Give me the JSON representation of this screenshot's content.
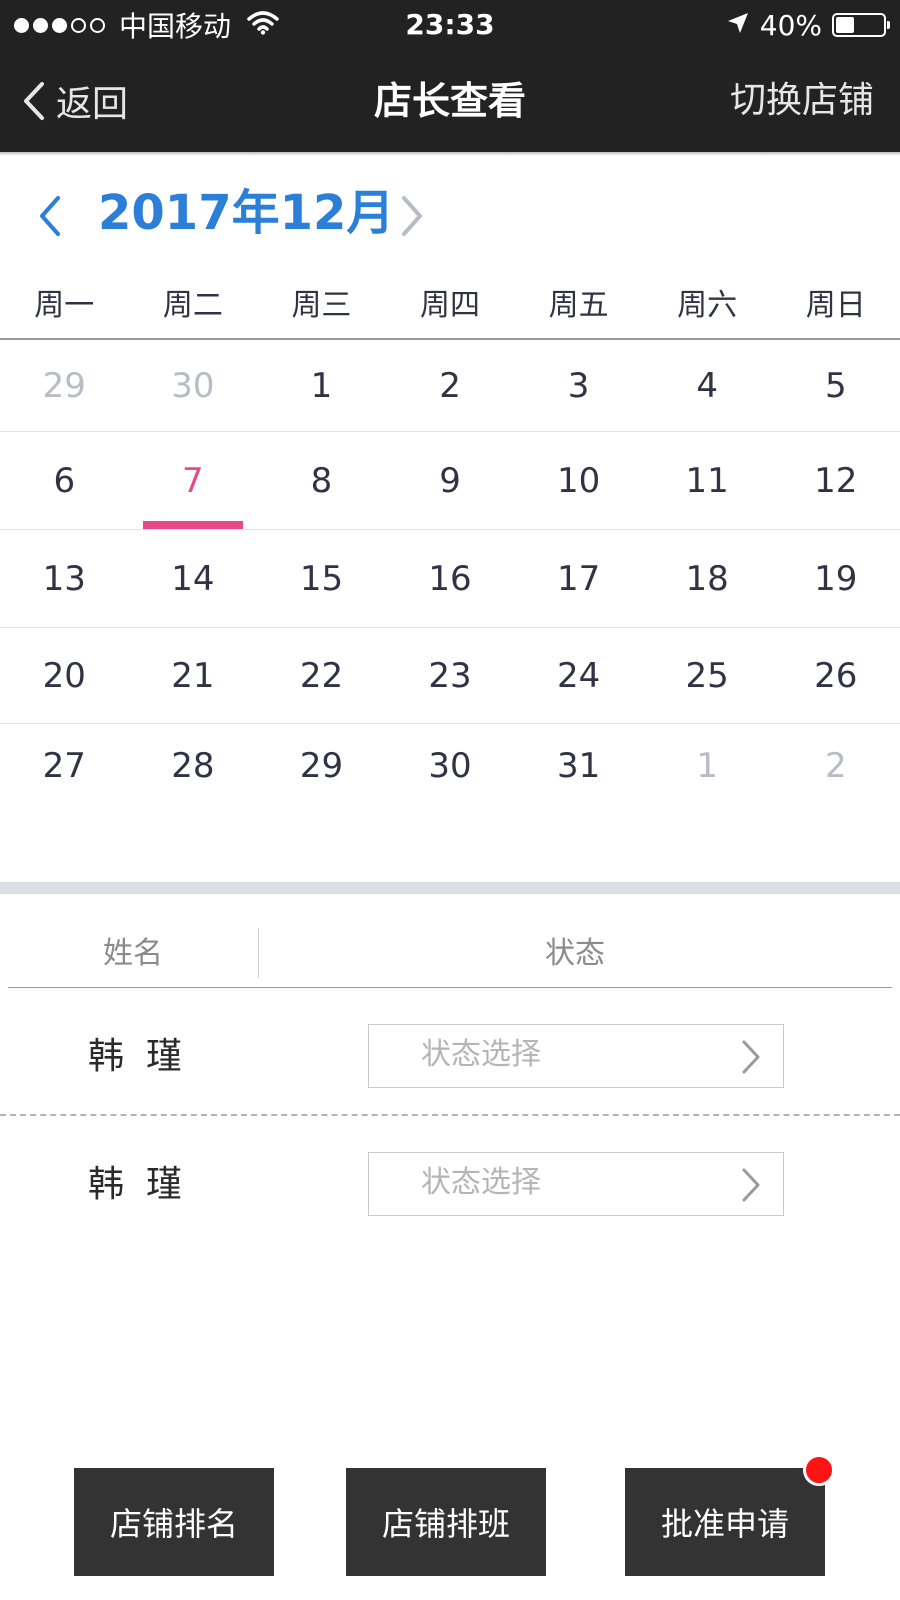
{
  "status_bar": {
    "carrier": "中国移动",
    "time": "23:33",
    "battery": "40%",
    "battery_level": 0.4,
    "signal_bars_filled": 3,
    "signal_bars_total": 5
  },
  "nav": {
    "back_label": "返回",
    "title": "店长查看",
    "switch_label": "切换店铺"
  },
  "calendar": {
    "month_label": "2017年12月",
    "accent_color": "#2b7fd6",
    "today_color": "#e74a86",
    "weekdays": [
      "周一",
      "周二",
      "周三",
      "周四",
      "周五",
      "周六",
      "周日"
    ],
    "weeks": [
      [
        {
          "d": "29",
          "m": true
        },
        {
          "d": "30",
          "m": true
        },
        {
          "d": "1"
        },
        {
          "d": "2"
        },
        {
          "d": "3"
        },
        {
          "d": "4"
        },
        {
          "d": "5"
        }
      ],
      [
        {
          "d": "6"
        },
        {
          "d": "7",
          "t": true
        },
        {
          "d": "8"
        },
        {
          "d": "9"
        },
        {
          "d": "10"
        },
        {
          "d": "11"
        },
        {
          "d": "12"
        }
      ],
      [
        {
          "d": "13"
        },
        {
          "d": "14"
        },
        {
          "d": "15"
        },
        {
          "d": "16"
        },
        {
          "d": "17"
        },
        {
          "d": "18"
        },
        {
          "d": "19"
        }
      ],
      [
        {
          "d": "20"
        },
        {
          "d": "21"
        },
        {
          "d": "22"
        },
        {
          "d": "23"
        },
        {
          "d": "24"
        },
        {
          "d": "25"
        },
        {
          "d": "26"
        }
      ],
      [
        {
          "d": "27"
        },
        {
          "d": "28"
        },
        {
          "d": "29"
        },
        {
          "d": "30"
        },
        {
          "d": "31"
        },
        {
          "d": "1",
          "m": true
        },
        {
          "d": "2",
          "m": true
        }
      ]
    ]
  },
  "staff_list": {
    "col_name": "姓名",
    "col_status": "状态",
    "rows": [
      {
        "name": "韩瑾",
        "status_placeholder": "状态选择"
      },
      {
        "name": "韩瑾",
        "status_placeholder": "状态选择"
      }
    ]
  },
  "bottom_buttons": [
    {
      "label": "店铺排名"
    },
    {
      "label": "店铺排班"
    },
    {
      "label": "批准申请",
      "badge": true
    }
  ]
}
